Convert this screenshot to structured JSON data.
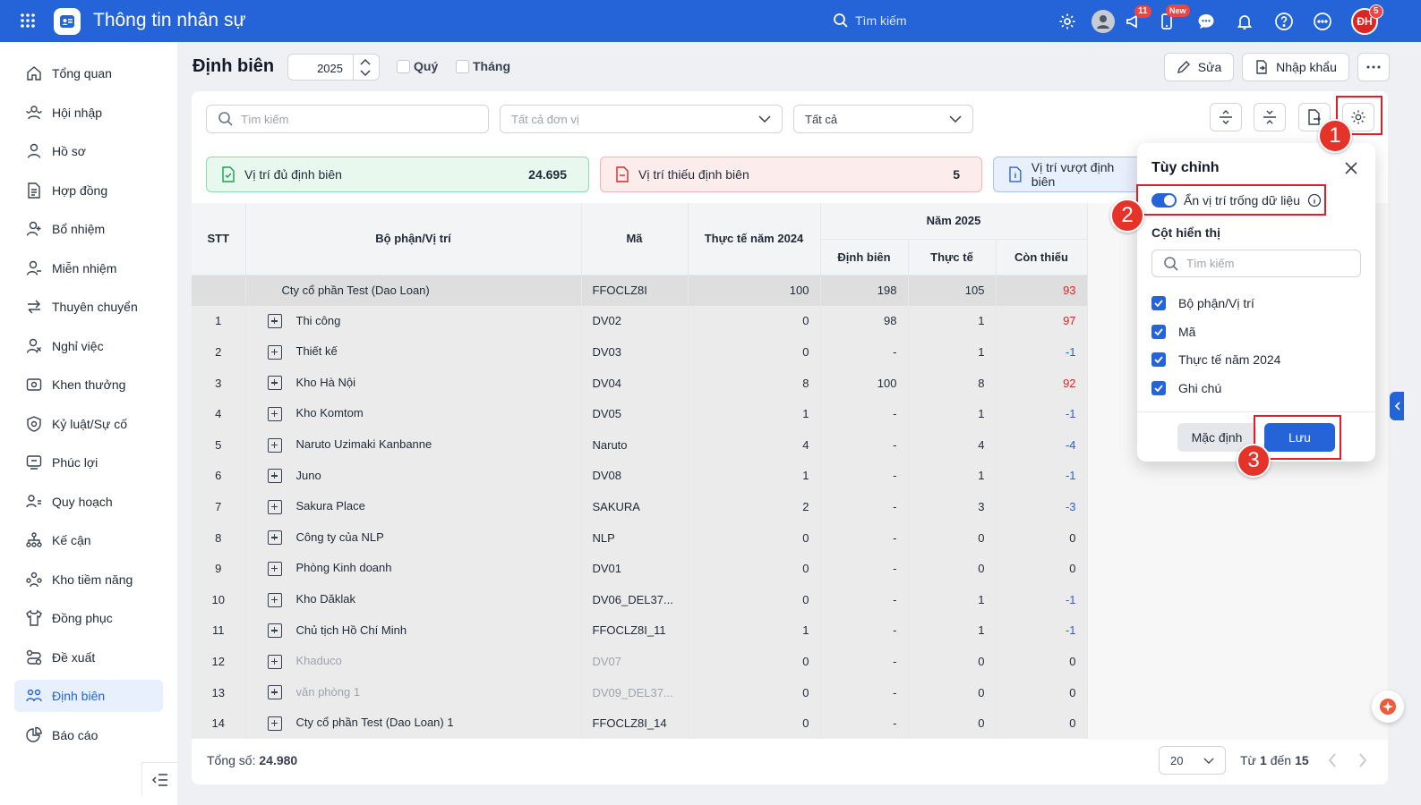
{
  "app": {
    "title": "Thông tin nhân sự",
    "search_placeholder": "Tìm kiếm",
    "badges": {
      "announce": "11",
      "new": "New",
      "avatar": "5"
    },
    "avatar_initials": "ĐH"
  },
  "sidebar": {
    "items": [
      {
        "label": "Tổng quan",
        "icon": "home-icon"
      },
      {
        "label": "Hội nhập",
        "icon": "users-icon"
      },
      {
        "label": "Hồ sơ",
        "icon": "user-icon"
      },
      {
        "label": "Hợp đồng",
        "icon": "document-icon"
      },
      {
        "label": "Bổ nhiệm",
        "icon": "user-plus-icon"
      },
      {
        "label": "Miễn nhiệm",
        "icon": "user-minus-icon"
      },
      {
        "label": "Thuyên chuyển",
        "icon": "transfer-icon"
      },
      {
        "label": "Nghỉ việc",
        "icon": "user-x-icon"
      },
      {
        "label": "Khen thưởng",
        "icon": "reward-icon"
      },
      {
        "label": "Kỷ luật/Sự cố",
        "icon": "shield-icon"
      },
      {
        "label": "Phúc lợi",
        "icon": "benefit-icon"
      },
      {
        "label": "Quy hoạch",
        "icon": "planning-icon"
      },
      {
        "label": "Kế cận",
        "icon": "org-icon"
      },
      {
        "label": "Kho tiềm năng",
        "icon": "talent-icon"
      },
      {
        "label": "Đồng phục",
        "icon": "shirt-icon"
      },
      {
        "label": "Đề xuất",
        "icon": "proposal-icon"
      },
      {
        "label": "Định biên",
        "icon": "headcount-icon",
        "active": true
      },
      {
        "label": "Báo cáo",
        "icon": "report-icon"
      }
    ]
  },
  "header": {
    "title": "Định biên",
    "year": "2025",
    "quarter_label": "Quý",
    "month_label": "Tháng",
    "edit_label": "Sửa",
    "import_label": "Nhập khẩu"
  },
  "filters": {
    "search_placeholder": "Tìm kiếm",
    "unit_placeholder": "Tất cả đơn vị",
    "status_value": "Tất cả"
  },
  "stats": [
    {
      "label": "Vị trí đủ định biên",
      "value": "24.695"
    },
    {
      "label": "Vị trí thiếu định biên",
      "value": "5"
    },
    {
      "label": "Vị trí vượt định biên",
      "value": ""
    }
  ],
  "table": {
    "headers": {
      "stt": "STT",
      "dept": "Bộ phận/Vị trí",
      "code": "Mã",
      "actual_prev": "Thực tế năm 2024",
      "year_group": "Năm 2025",
      "quota": "Định biên",
      "actual": "Thực tế",
      "shortage": "Còn thiếu"
    },
    "summary": {
      "name": "Cty cổ phần Test (Dao Loan)",
      "code": "FFOCLZ8I",
      "actual_prev": "100",
      "quota": "198",
      "actual": "105",
      "shortage": "93"
    },
    "rows": [
      {
        "stt": "1",
        "name": "Thi công",
        "code": "DV02",
        "actual_prev": "0",
        "quota": "98",
        "actual": "1",
        "shortage": "97",
        "tone": "red"
      },
      {
        "stt": "2",
        "name": "Thiết kế",
        "code": "DV03",
        "actual_prev": "0",
        "quota": "-",
        "actual": "1",
        "shortage": "-1",
        "tone": "blue"
      },
      {
        "stt": "3",
        "name": "Kho Hà Nội",
        "code": "DV04",
        "actual_prev": "8",
        "quota": "100",
        "actual": "8",
        "shortage": "92",
        "tone": "red"
      },
      {
        "stt": "4",
        "name": "Kho Komtom",
        "code": "DV05",
        "actual_prev": "1",
        "quota": "-",
        "actual": "1",
        "shortage": "-1",
        "tone": "blue"
      },
      {
        "stt": "5",
        "name": "Naruto Uzimaki Kanbanne",
        "code": "Naruto",
        "actual_prev": "4",
        "quota": "-",
        "actual": "4",
        "shortage": "-4",
        "tone": "blue"
      },
      {
        "stt": "6",
        "name": "Juno",
        "code": "DV08",
        "actual_prev": "1",
        "quota": "-",
        "actual": "1",
        "shortage": "-1",
        "tone": "blue"
      },
      {
        "stt": "7",
        "name": "Sakura Place",
        "code": "SAKURA",
        "actual_prev": "2",
        "quota": "-",
        "actual": "3",
        "shortage": "-3",
        "tone": "blue"
      },
      {
        "stt": "8",
        "name": "Công ty của NLP",
        "code": "NLP",
        "actual_prev": "0",
        "quota": "-",
        "actual": "0",
        "shortage": "0",
        "tone": ""
      },
      {
        "stt": "9",
        "name": "Phòng Kinh doanh",
        "code": "DV01",
        "actual_prev": "0",
        "quota": "-",
        "actual": "0",
        "shortage": "0",
        "tone": ""
      },
      {
        "stt": "10",
        "name": "Kho Dăklak",
        "code": "DV06_DEL37...",
        "actual_prev": "0",
        "quota": "-",
        "actual": "1",
        "shortage": "-1",
        "tone": "blue"
      },
      {
        "stt": "11",
        "name": "Chủ tịch Hồ Chí Minh",
        "code": "FFOCLZ8I_11",
        "actual_prev": "1",
        "quota": "-",
        "actual": "1",
        "shortage": "-1",
        "tone": "blue"
      },
      {
        "stt": "12",
        "name": "Khaduco",
        "code": "DV07",
        "actual_prev": "0",
        "quota": "-",
        "actual": "0",
        "shortage": "0",
        "tone": "",
        "muted": true
      },
      {
        "stt": "13",
        "name": "văn phòng 1",
        "code": "DV09_DEL37...",
        "actual_prev": "0",
        "quota": "-",
        "actual": "0",
        "shortage": "0",
        "tone": "",
        "muted": true
      },
      {
        "stt": "14",
        "name": "Cty cổ phần Test (Dao Loan) 1",
        "code": "FFOCLZ8I_14",
        "actual_prev": "0",
        "quota": "-",
        "actual": "0",
        "shortage": "0",
        "tone": ""
      }
    ]
  },
  "footer": {
    "total_label": "Tổng số:",
    "total_value": "24.980",
    "page_size": "20",
    "range_prefix": "Từ",
    "range_from": "1",
    "range_mid": "đến",
    "range_to": "15"
  },
  "popover": {
    "title": "Tùy chỉnh",
    "toggle_label": "Ẩn vị trí trống dữ liệu",
    "toggle_on": true,
    "columns_title": "Cột hiển thị",
    "search_placeholder": "Tìm kiếm",
    "columns": [
      "Bộ phận/Vị trí",
      "Mã",
      "Thực tế năm 2024",
      "Ghi chú"
    ],
    "default_label": "Mặc định",
    "save_label": "Lưu"
  },
  "steps": [
    "1",
    "2",
    "3"
  ],
  "colors": {
    "primary": "#2563d9",
    "danger": "#dc2626",
    "annotation": "#e11d2a"
  }
}
